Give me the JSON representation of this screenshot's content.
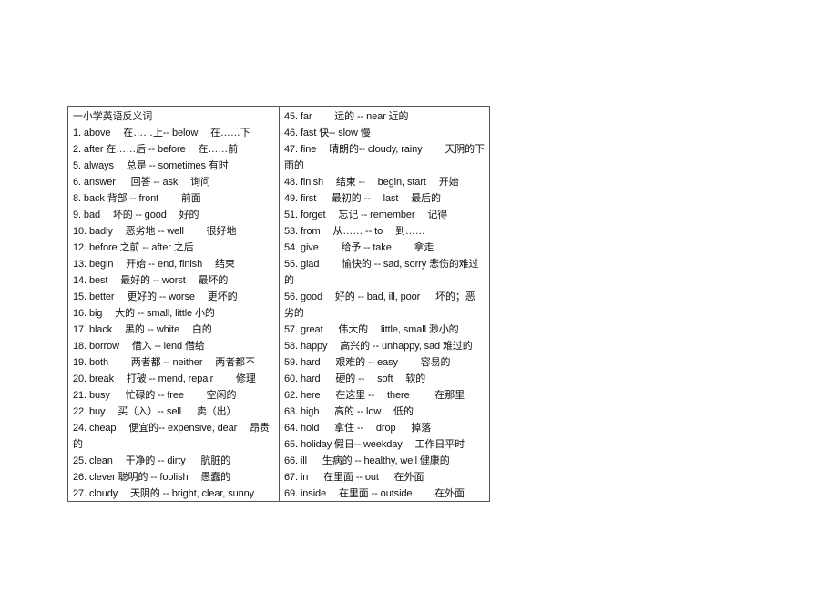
{
  "document": {
    "left_column": [
      "一小学英语反义词",
      "1. above 　在……上-- below 　在……下",
      "2. after 在……后 -- before 　在……前",
      "5. always 　总是 -- sometimes 有时",
      "6. answer 　 回答 -- ask 　询问",
      "8. back 背部 -- front 　　前面",
      "9. bad 　坏的 -- good 　好的",
      "10. badly 　恶劣地 -- well 　　很好地",
      "12. before 之前 -- after 之后",
      "13. begin 　开始 -- end, finish 　结束",
      "14. best 　最好的 -- worst 　最坏的",
      "15. better 　更好的 -- worse 　更坏的",
      "16. big 　大的 -- small, little 小的",
      "17. black 　黑的 -- white 　白的",
      "18. borrow 　借入 -- lend 借给",
      "19. both 　　两者都 -- neither 　两者都不",
      "20. break 　打破 -- mend, repair 　　修理",
      "21. busy 　 忙碌的 -- free 　　空闲的",
      "22. buy 　买（入）-- sell 　 卖（出）",
      "24. cheap 　便宜的-- expensive, dear 　昂贵",
      "的",
      "25. clean 　干净的 -- dirty 　 肮脏的",
      "26. clever 聪明的 -- foolish 　愚蠢的",
      "27. cloudy 　天阴的 -- bright, clear, sunny"
    ],
    "right_column": [
      "45. far 　　远的 -- near 近的",
      "46. fast 快-- slow 慢",
      "47. fine 　晴朗的-- cloudy, rainy 　　天阴的下",
      "雨的",
      "48. finish 　结束 -- 　begin, start 　开始",
      "49. first 　 最初的 -- 　last 　最后的",
      "51. forget 　忘记 -- remember 　记得",
      "53. from 　从…… -- to 　到……",
      "54. give 　　给予 -- take 　　拿走",
      "55. glad 　　愉快的 -- sad, sorry 悲伤的难过",
      "的",
      "56. good 　好的 -- bad, ill, poor 　 坏的；恶",
      "劣的",
      "57. great 　 伟大的 　little, small 渺小的",
      "58. happy 　高兴的 -- unhappy, sad 难过的",
      "59. hard 　 艰难的 -- easy 　　容易的",
      "60. hard 　 硬的 -- 　soft 　软的",
      "62. here 　 在这里 -- 　there 　　 在那里",
      "63. high 　 高的 -- low 　低的",
      "64. hold 　 拿住 -- 　drop 　 掉落",
      "65. holiday 假日-- weekday 　工作日平时",
      "66. ill 　 生病的 -- healthy, well 健康的",
      "67. in 　 在里面 -- out 　 在外面",
      "69. inside 　在里面 -- outside 　　在外面"
    ]
  }
}
